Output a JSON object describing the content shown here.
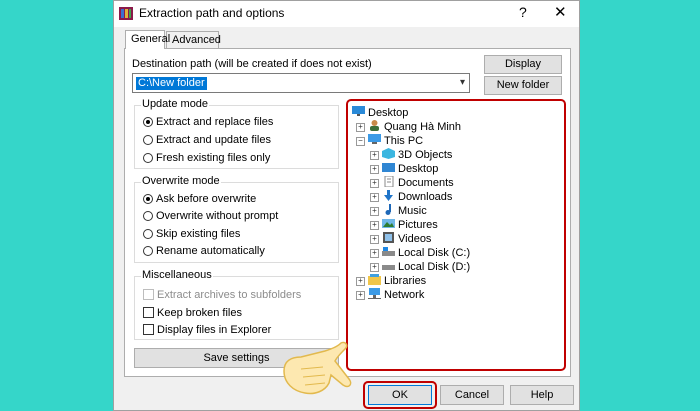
{
  "window": {
    "title": "Extraction path and options",
    "help_glyph": "?",
    "close_glyph": "✕"
  },
  "tabs": [
    {
      "label": "General",
      "active": true
    },
    {
      "label": "Advanced",
      "active": false
    }
  ],
  "destination": {
    "label": "Destination path (will be created if does not exist)",
    "value": "C:\\New folder"
  },
  "buttons": {
    "display": "Display",
    "new_folder": "New folder",
    "save_settings": "Save settings",
    "ok": "OK",
    "cancel": "Cancel",
    "help": "Help"
  },
  "update_mode": {
    "title": "Update mode",
    "options": [
      {
        "label": "Extract and replace files",
        "selected": true
      },
      {
        "label": "Extract and update files",
        "selected": false
      },
      {
        "label": "Fresh existing files only",
        "selected": false
      }
    ]
  },
  "overwrite_mode": {
    "title": "Overwrite mode",
    "options": [
      {
        "label": "Ask before overwrite",
        "selected": true
      },
      {
        "label": "Overwrite without prompt",
        "selected": false
      },
      {
        "label": "Skip existing files",
        "selected": false
      },
      {
        "label": "Rename automatically",
        "selected": false
      }
    ]
  },
  "misc": {
    "title": "Miscellaneous",
    "options": [
      {
        "label": "Extract archives to subfolders",
        "checked": false,
        "disabled": true
      },
      {
        "label": "Keep broken files",
        "checked": false,
        "disabled": false
      },
      {
        "label": "Display files in Explorer",
        "checked": false,
        "disabled": false
      }
    ]
  },
  "tree": [
    {
      "label": "Desktop",
      "icon": "desktop-icon",
      "level": 0,
      "expander": ""
    },
    {
      "label": "Quang Hà Minh",
      "icon": "user-icon",
      "level": 1,
      "expander": "+"
    },
    {
      "label": "This PC",
      "icon": "computer-icon",
      "level": 1,
      "expander": "−"
    },
    {
      "label": "3D Objects",
      "icon": "3d-objects-icon",
      "level": 2,
      "expander": "+"
    },
    {
      "label": "Desktop",
      "icon": "desktop-icon",
      "level": 2,
      "expander": "+"
    },
    {
      "label": "Documents",
      "icon": "documents-icon",
      "level": 2,
      "expander": "+"
    },
    {
      "label": "Downloads",
      "icon": "downloads-icon",
      "level": 2,
      "expander": "+"
    },
    {
      "label": "Music",
      "icon": "music-icon",
      "level": 2,
      "expander": "+"
    },
    {
      "label": "Pictures",
      "icon": "pictures-icon",
      "level": 2,
      "expander": "+"
    },
    {
      "label": "Videos",
      "icon": "videos-icon",
      "level": 2,
      "expander": "+"
    },
    {
      "label": "Local Disk (C:)",
      "icon": "drive-icon",
      "level": 2,
      "expander": "+"
    },
    {
      "label": "Local Disk (D:)",
      "icon": "drive-icon",
      "level": 2,
      "expander": "+"
    },
    {
      "label": "Libraries",
      "icon": "libraries-icon",
      "level": 1,
      "expander": "+"
    },
    {
      "label": "Network",
      "icon": "network-icon",
      "level": 1,
      "expander": "+"
    }
  ],
  "colors": {
    "background": "#35d6c9",
    "highlight_ring": "#c00000",
    "selection": "#0078d7"
  }
}
